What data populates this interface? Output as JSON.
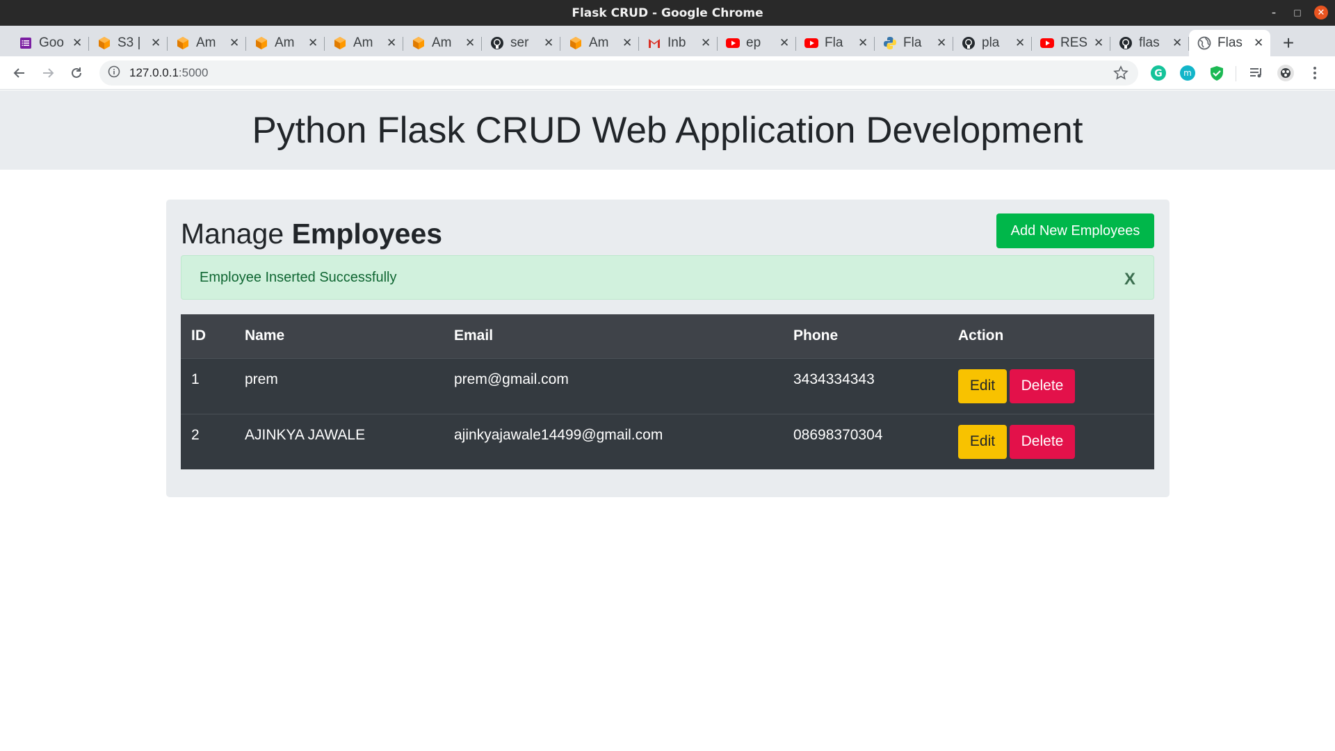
{
  "window": {
    "title": "Flask CRUD - Google Chrome"
  },
  "tabs": [
    {
      "label": "Goo",
      "icon": "google-forms-icon",
      "color": "#7b1fa2"
    },
    {
      "label": "S3 |",
      "icon": "aws-icon",
      "color": "#ff9900"
    },
    {
      "label": "Am",
      "icon": "aws-icon",
      "color": "#ff9900"
    },
    {
      "label": "Am",
      "icon": "aws-icon",
      "color": "#ff9900"
    },
    {
      "label": "Am",
      "icon": "aws-icon",
      "color": "#ff9900"
    },
    {
      "label": "Am",
      "icon": "aws-icon",
      "color": "#ff9900"
    },
    {
      "label": "ser",
      "icon": "github-icon",
      "color": "#24292e"
    },
    {
      "label": "Am",
      "icon": "aws-icon",
      "color": "#ff9900"
    },
    {
      "label": "Inb",
      "icon": "gmail-icon",
      "color": "#d93025"
    },
    {
      "label": "ep",
      "icon": "youtube-icon",
      "color": "#ff0000"
    },
    {
      "label": "Fla",
      "icon": "youtube-icon",
      "color": "#ff0000"
    },
    {
      "label": "Fla",
      "icon": "python-icon",
      "color": "#3776ab"
    },
    {
      "label": "pla",
      "icon": "github-icon",
      "color": "#24292e"
    },
    {
      "label": "RES",
      "icon": "youtube-icon",
      "color": "#ff0000"
    },
    {
      "label": "flas",
      "icon": "github-icon",
      "color": "#24292e"
    },
    {
      "label": "Flas",
      "icon": "globe-icon",
      "color": "#5f6368",
      "active": true
    }
  ],
  "address": {
    "host": "127.0.0.1",
    "port": ":5000"
  },
  "page": {
    "heading": "Python Flask CRUD Web Application Development",
    "manage_prefix": "Manage",
    "manage_strong": "Employees",
    "add_button": "Add New Employees",
    "alert_text": "Employee Inserted Successfully",
    "alert_close": "X"
  },
  "table": {
    "headers": [
      "ID",
      "Name",
      "Email",
      "Phone",
      "Action"
    ],
    "rows": [
      {
        "id": "1",
        "name": "prem",
        "email": "prem@gmail.com",
        "phone": "3434334343",
        "edit": "Edit",
        "delete": "Delete"
      },
      {
        "id": "2",
        "name": "AJINKYA JAWALE",
        "email": "ajinkyajawale14499@gmail.com",
        "phone": "08698370304",
        "edit": "Edit",
        "delete": "Delete"
      }
    ]
  },
  "colors": {
    "add": "#00b74a",
    "edit": "#f8c200",
    "delete": "#e3114a",
    "table": "#343a40",
    "alert": "#d1f1dd"
  }
}
